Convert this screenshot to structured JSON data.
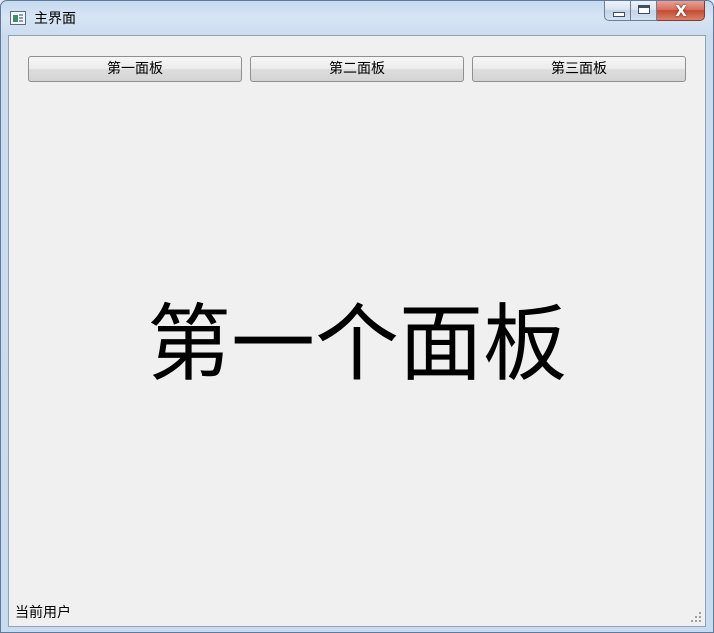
{
  "window": {
    "title": "主界面",
    "icon": "app-window-icon",
    "controls": {
      "minimize_icon": "minimize-icon",
      "maximize_icon": "maximize-icon",
      "close_icon": "close-icon",
      "close_glyph": "X"
    }
  },
  "toolbar": {
    "buttons": [
      {
        "label": "第一面板"
      },
      {
        "label": "第二面板"
      },
      {
        "label": "第三面板"
      }
    ]
  },
  "main": {
    "panel_heading": "第一个面板"
  },
  "statusbar": {
    "text": "当前用户",
    "grip_icon": "resize-grip-icon"
  },
  "colors": {
    "close_button": "#c44a31",
    "client_background": "#f0f0f0",
    "frame": "#c9dbee"
  }
}
